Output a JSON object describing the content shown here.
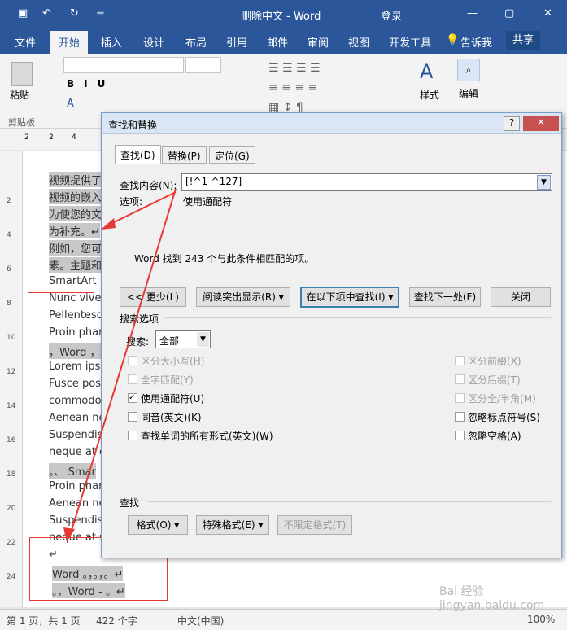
{
  "titlebar": {
    "title": "删除中文 - Word",
    "login": "登录",
    "minimize": "—",
    "restore": "▢",
    "close": "✕"
  },
  "tabs": [
    "文件",
    "开始",
    "插入",
    "设计",
    "布局",
    "引用",
    "邮件",
    "审阅",
    "视图",
    "开发工具"
  ],
  "tell_me": "告诉我",
  "share": "共享",
  "ribbon": {
    "paste": "粘贴",
    "clipboard": "剪贴板",
    "styles": "样式",
    "editing": "编辑"
  },
  "ruler_nums": [
    "2",
    "2",
    "4"
  ],
  "vruler_nums": [
    "2",
    "4",
    "6",
    "8",
    "10",
    "12",
    "14",
    "16",
    "18",
    "20",
    "22",
    "24"
  ],
  "doc_lines": [
    "视频提供了",
    "视频的嵌入",
    "为使您的文",
    "为补充。↵",
    "例如，您可",
    "素。主题和",
    "SmartArt",
    "Nunc viver",
    "Pellentesqu",
    "Proin phar",
    "，Word ，",
    "Lorem ipsu",
    "Fusce pos",
    "commodo",
    "Aenean ne",
    "Suspendis",
    "neque at e",
    "。、 Smar",
    "Proin phar",
    "Aenean ne",
    "Suspendiss",
    "neque at se",
    "↵",
    "Word  。，。，。↵",
    "。，Word  -  。↵"
  ],
  "status": {
    "page": "第 1 页，共 1 页",
    "words": "422 个字",
    "lang": "中文(中国)",
    "zoom": "100%"
  },
  "dialog": {
    "title": "查找和替换",
    "help": "?",
    "close": "✕",
    "tabs": [
      "查找(D)",
      "替换(P)",
      "定位(G)"
    ],
    "find_label": "查找内容(N):",
    "find_value": "[!^1-^127]",
    "options_label": "选项:",
    "options_value": "使用通配符",
    "message": "Word 找到 243 个与此条件相匹配的项。",
    "buttons": {
      "less": "<< 更少(L)",
      "reading": "阅读突出显示(R) ▾",
      "findin": "在以下项中查找(I) ▾",
      "next": "查找下一处(F)",
      "close": "关闭"
    },
    "search_options": "搜索选项",
    "search_label": "搜索:",
    "search_value": "全部",
    "left_opts": [
      "区分大小写(H)",
      "全字匹配(Y)",
      "使用通配符(U)",
      "同音(英文)(K)",
      "查找单词的所有形式(英文)(W)"
    ],
    "right_opts": [
      "区分前缀(X)",
      "区分后缀(T)",
      "区分全/半角(M)",
      "忽略标点符号(S)",
      "忽略空格(A)"
    ],
    "find_section": "查找",
    "format_btns": [
      "格式(O) ▾",
      "特殊格式(E) ▾",
      "不限定格式(T)"
    ]
  },
  "watermark": "Bai 经验 jingyan.baidu.com"
}
